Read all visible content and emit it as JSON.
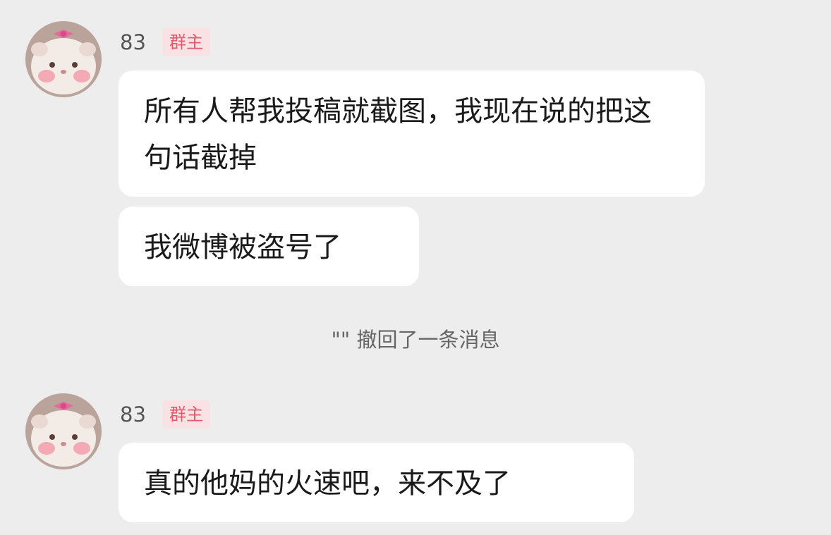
{
  "messages": [
    {
      "sender": "83",
      "badge": "群主",
      "avatar_icon": "hamster-with-pink-bow",
      "bubbles": [
        "所有人帮我投稿就截图，我现在说的把这句话截掉",
        "我微博被盗号了"
      ]
    },
    {
      "sender": "83",
      "badge": "群主",
      "avatar_icon": "hamster-with-pink-bow",
      "bubbles": [
        "真的他妈的火速吧，来不及了"
      ]
    }
  ],
  "system_notice": "\"\" 撤回了一条消息",
  "colors": {
    "background": "#ededed",
    "bubble": "#ffffff",
    "badge_text": "#e45a6e",
    "badge_bg": "#f9e1e4"
  }
}
